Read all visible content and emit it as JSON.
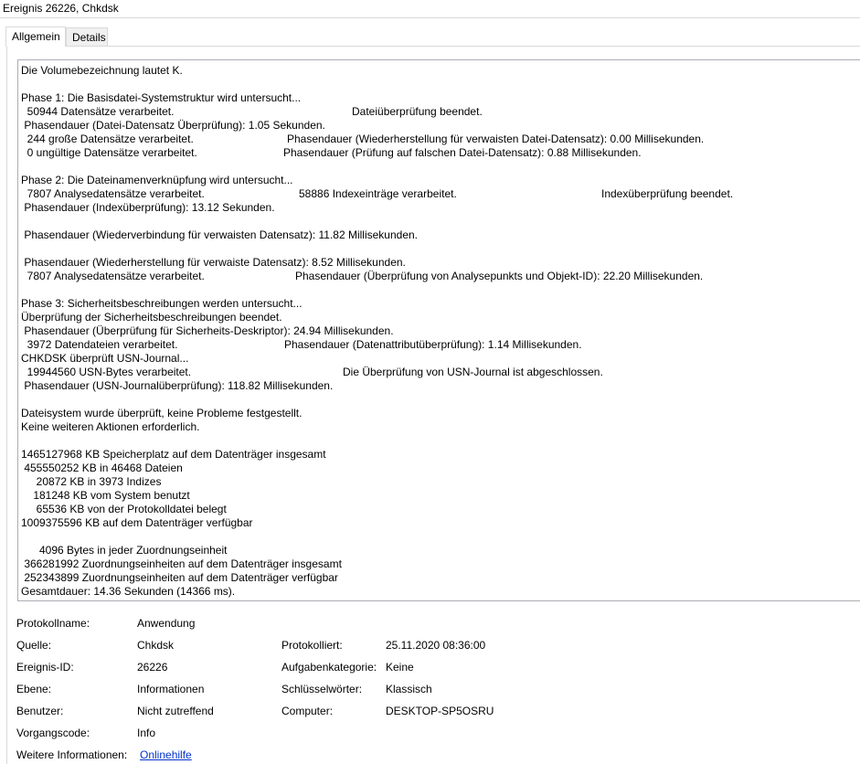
{
  "window": {
    "title": "Ereignis 26226, Chkdsk"
  },
  "tabs": [
    {
      "label": "Allgemein"
    },
    {
      "label": "Details"
    }
  ],
  "message": {
    "lines": [
      [
        "Die Volumebezeichnung lautet K."
      ],
      [
        ""
      ],
      [
        "Phase 1: Die Basisdatei-Systemstruktur wird untersucht..."
      ],
      [
        "  50944 Datensätze verarbeitet.",
        "Dateiüberprüfung beendet."
      ],
      [
        " Phasendauer (Datei-Datensatz Überprüfung): 1.05 Sekunden."
      ],
      [
        "  244 große Datensätze verarbeitet.",
        "Phasendauer (Wiederherstellung für verwaisten Datei-Datensatz): 0.00 Millisekunden."
      ],
      [
        "  0 ungültige Datensätze verarbeitet.",
        "Phasendauer (Prüfung auf falschen Datei-Datensatz): 0.88 Millisekunden."
      ],
      [
        ""
      ],
      [
        "Phase 2: Die Dateinamenverknüpfung wird untersucht..."
      ],
      [
        "  7807 Analysedatensätze verarbeitet.",
        "58886 Indexeinträge verarbeitet.",
        "Indexüberprüfung beendet."
      ],
      [
        " Phasendauer (Indexüberprüfung): 13.12 Sekunden."
      ],
      [
        ""
      ],
      [
        " Phasendauer (Wiederverbindung für verwaisten Datensatz): 11.82 Millisekunden."
      ],
      [
        ""
      ],
      [
        " Phasendauer (Wiederherstellung für verwaiste Datensatz): 8.52 Millisekunden."
      ],
      [
        "  7807 Analysedatensätze verarbeitet.",
        "Phasendauer (Überprüfung von Analysepunkts und Objekt-ID): 22.20 Millisekunden."
      ],
      [
        ""
      ],
      [
        "Phase 3: Sicherheitsbeschreibungen werden untersucht..."
      ],
      [
        "Überprüfung der Sicherheitsbeschreibungen beendet."
      ],
      [
        " Phasendauer (Überprüfung für Sicherheits-Deskriptor): 24.94 Millisekunden."
      ],
      [
        "  3972 Datendateien verarbeitet.",
        "Phasendauer (Datenattributüberprüfung): 1.14 Millisekunden."
      ],
      [
        "CHKDSK überprüft USN-Journal..."
      ],
      [
        "  19944560 USN-Bytes verarbeitet.",
        "Die Überprüfung von USN-Journal ist abgeschlossen."
      ],
      [
        " Phasendauer (USN-Journalüberprüfung): 118.82 Millisekunden."
      ],
      [
        ""
      ],
      [
        "Dateisystem wurde überprüft, keine Probleme festgestellt."
      ],
      [
        "Keine weiteren Aktionen erforderlich."
      ],
      [
        ""
      ],
      [
        "1465127968 KB Speicherplatz auf dem Datenträger insgesamt"
      ],
      [
        " 455550252 KB in 46468 Dateien"
      ],
      [
        "     20872 KB in 3973 Indizes"
      ],
      [
        "    181248 KB vom System benutzt"
      ],
      [
        "     65536 KB von der Protokolldatei belegt"
      ],
      [
        "1009375596 KB auf dem Datenträger verfügbar"
      ],
      [
        ""
      ],
      [
        "      4096 Bytes in jeder Zuordnungseinheit"
      ],
      [
        " 366281992 Zuordnungseinheiten auf dem Datenträger insgesamt"
      ],
      [
        " 252343899 Zuordnungseinheiten auf dem Datenträger verfügbar"
      ],
      [
        "Gesamtdauer: 14.36 Sekunden (14366 ms)."
      ]
    ]
  },
  "properties": {
    "protokollname_label": "Protokollname:",
    "protokollname": "Anwendung",
    "quelle_label": "Quelle:",
    "quelle": "Chkdsk",
    "protokolliert_label": "Protokolliert:",
    "protokolliert": "25.11.2020 08:36:00",
    "ereignis_id_label": "Ereignis-ID:",
    "ereignis_id": "26226",
    "aufgabenkategorie_label": "Aufgabenkategorie:",
    "aufgabenkategorie": "Keine",
    "ebene_label": "Ebene:",
    "ebene": "Informationen",
    "schluesselwoerter_label": "Schlüsselwörter:",
    "schluesselwoerter": "Klassisch",
    "benutzer_label": "Benutzer:",
    "benutzer": "Nicht zutreffend",
    "computer_label": "Computer:",
    "computer": "DESKTOP-SP5OSRU",
    "vorgangscode_label": "Vorgangscode:",
    "vorgangscode": "Info",
    "weitere_label": "Weitere Informationen:",
    "weitere_link": "Onlinehilfe"
  }
}
